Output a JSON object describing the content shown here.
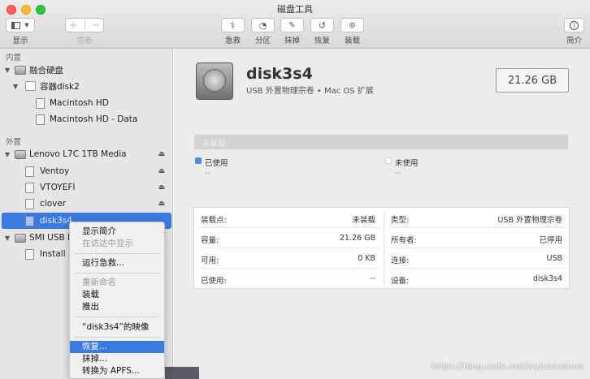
{
  "window": {
    "title": "磁盘工具"
  },
  "toolbar": {
    "view_label": "显示",
    "volume_label": "宗卷",
    "first_aid_label": "急救",
    "partition_label": "分区",
    "erase_label": "抹掉",
    "restore_label": "恢复",
    "mount_label": "装载",
    "info_label": "简介"
  },
  "sidebar": {
    "internal_title": "内置",
    "external_title": "外置",
    "internal": [
      {
        "label": "融合硬盘"
      },
      {
        "label": "容器disk2"
      },
      {
        "label": "Macintosh HD"
      },
      {
        "label": "Macintosh HD - Data"
      }
    ],
    "external": [
      {
        "label": "Lenovo L7C 1TB Media"
      },
      {
        "label": "Ventoy"
      },
      {
        "label": "VTOYEFI"
      },
      {
        "label": "clover"
      },
      {
        "label": "disk3s4"
      },
      {
        "label": "SMI USB D"
      },
      {
        "label": "Install m"
      }
    ]
  },
  "detail": {
    "name": "disk3s4",
    "description": "USB 外置物理宗卷 • Mac OS 扩展",
    "size": "21.26 GB",
    "bar_label": "未装载",
    "used_label": "已使用",
    "used_value": "--",
    "free_label": "未使用",
    "free_value": "--",
    "left_rows": [
      {
        "key": "装载点:",
        "value": "未装载"
      },
      {
        "key": "容量:",
        "value": "21.26 GB"
      },
      {
        "key": "可用:",
        "value": "0 KB"
      },
      {
        "key": "已使用:",
        "value": "--"
      }
    ],
    "right_rows": [
      {
        "key": "类型:",
        "value": "USB 外置物理宗卷"
      },
      {
        "key": "所有者:",
        "value": "已停用"
      },
      {
        "key": "连接:",
        "value": "USB"
      },
      {
        "key": "设备:",
        "value": "disk3s4"
      }
    ]
  },
  "context_menu": {
    "items": [
      "显示简介",
      "在访达中显示",
      "运行急救...",
      "重新命名",
      "装载",
      "推出",
      "“disk3s4”的映像",
      "恢复...",
      "抹掉...",
      "转换为 APFS..."
    ]
  },
  "watermark": "https://blog.csdn.net/wybarcelona",
  "colors": {
    "accent": "#3b7ae0",
    "used": "#4a90e2"
  }
}
